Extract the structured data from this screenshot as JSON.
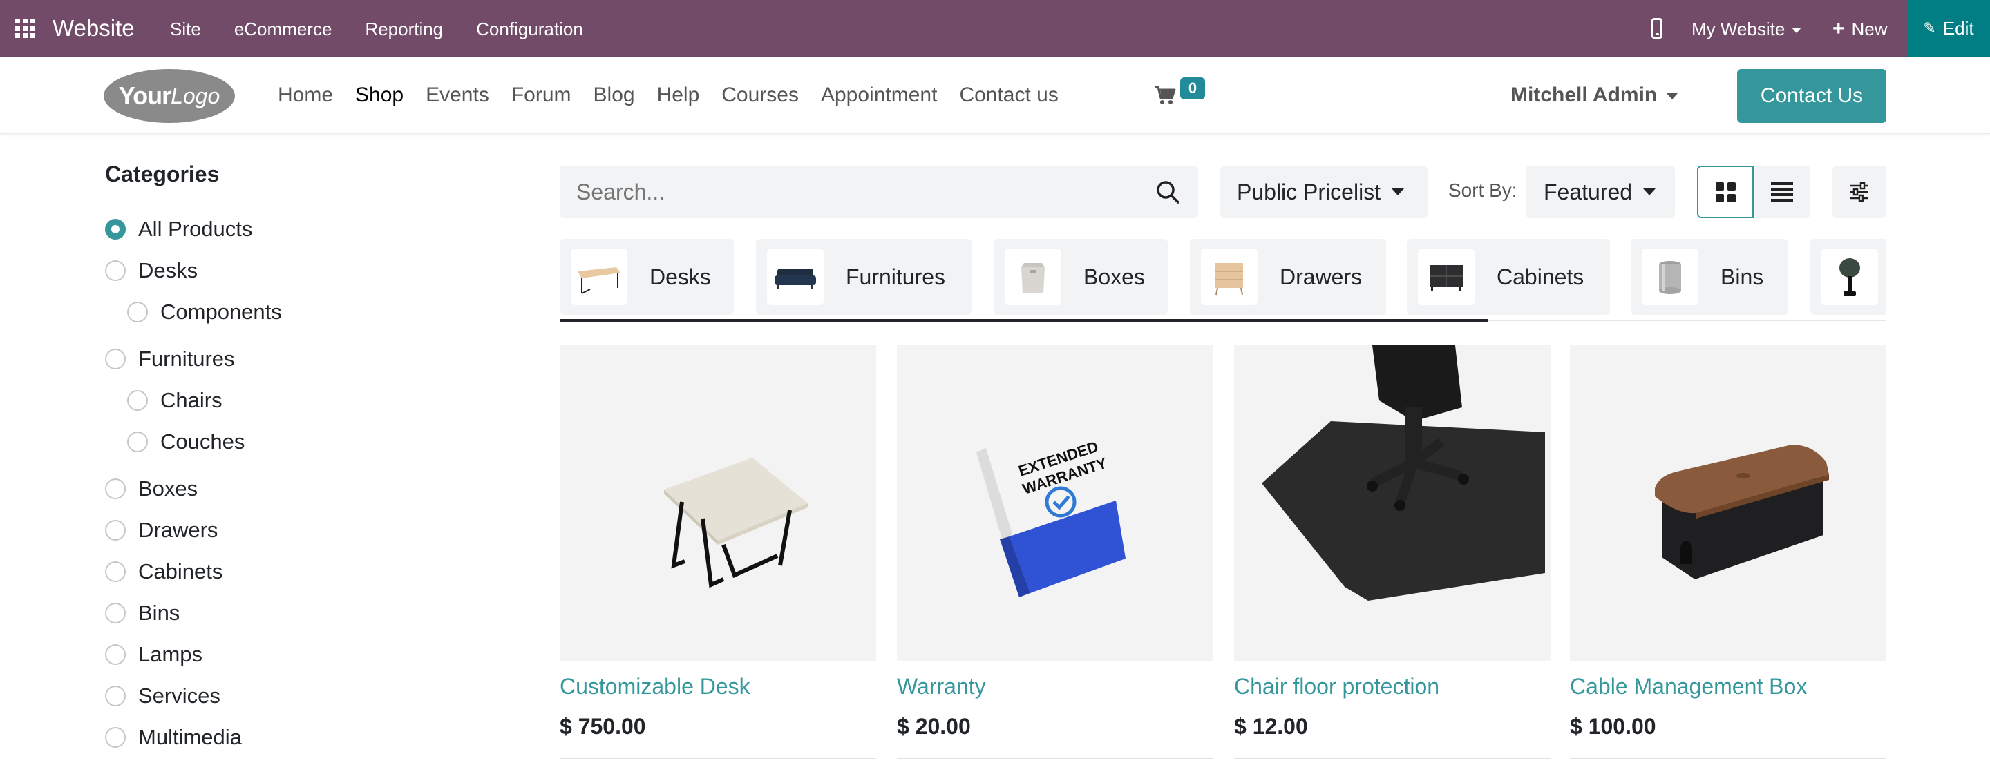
{
  "admin_bar": {
    "brand": "Website",
    "menu": [
      "Site",
      "eCommerce",
      "Reporting",
      "Configuration"
    ],
    "my_website": "My Website",
    "new_label": "New",
    "edit_label": "Edit",
    "color": "#714B67",
    "edit_color": "#017E84"
  },
  "site_header": {
    "logo_text_bold": "Your",
    "logo_text_light": "Logo",
    "nav": [
      "Home",
      "Shop",
      "Events",
      "Forum",
      "Blog",
      "Help",
      "Courses",
      "Appointment",
      "Contact us"
    ],
    "active_nav": "Shop",
    "cart_count": "0",
    "user": "Mitchell Admin",
    "contact_button": "Contact Us",
    "accent_color": "#35979C"
  },
  "sidebar": {
    "title": "Categories",
    "items": [
      {
        "label": "All Products",
        "checked": true
      },
      {
        "label": "Desks",
        "checked": false
      },
      {
        "label": "Components",
        "checked": false
      },
      {
        "label": "Furnitures",
        "checked": false
      },
      {
        "label": "Chairs",
        "checked": false
      },
      {
        "label": "Couches",
        "checked": false
      },
      {
        "label": "Boxes",
        "checked": false
      },
      {
        "label": "Drawers",
        "checked": false
      },
      {
        "label": "Cabinets",
        "checked": false
      },
      {
        "label": "Bins",
        "checked": false
      },
      {
        "label": "Lamps",
        "checked": false
      },
      {
        "label": "Services",
        "checked": false
      },
      {
        "label": "Multimedia",
        "checked": false
      }
    ]
  },
  "toolbar": {
    "search_placeholder": "Search...",
    "pricelist": "Public Pricelist",
    "sort_label": "Sort By:",
    "sort_value": "Featured"
  },
  "category_strip": {
    "items": [
      {
        "label": "Desks",
        "icon": "desk-thumbnail-icon"
      },
      {
        "label": "Furnitures",
        "icon": "sofa-thumbnail-icon"
      },
      {
        "label": "Boxes",
        "icon": "box-thumbnail-icon"
      },
      {
        "label": "Drawers",
        "icon": "drawer-thumbnail-icon"
      },
      {
        "label": "Cabinets",
        "icon": "cabinet-thumbnail-icon"
      },
      {
        "label": "Bins",
        "icon": "bin-thumbnail-icon"
      },
      {
        "label": "",
        "icon": "lamp-thumbnail-icon"
      }
    ]
  },
  "products": [
    {
      "name": "Customizable Desk",
      "price": "$ 750.00",
      "image": "desk-image"
    },
    {
      "name": "Warranty",
      "price": "$ 20.00",
      "image": "warranty-box-image",
      "box_text_1": "EXTENDED",
      "box_text_2": "WARRANTY"
    },
    {
      "name": "Chair floor protection",
      "price": "$ 12.00",
      "image": "floor-mat-image"
    },
    {
      "name": "Cable Management Box",
      "price": "$ 100.00",
      "image": "cable-box-image"
    }
  ]
}
